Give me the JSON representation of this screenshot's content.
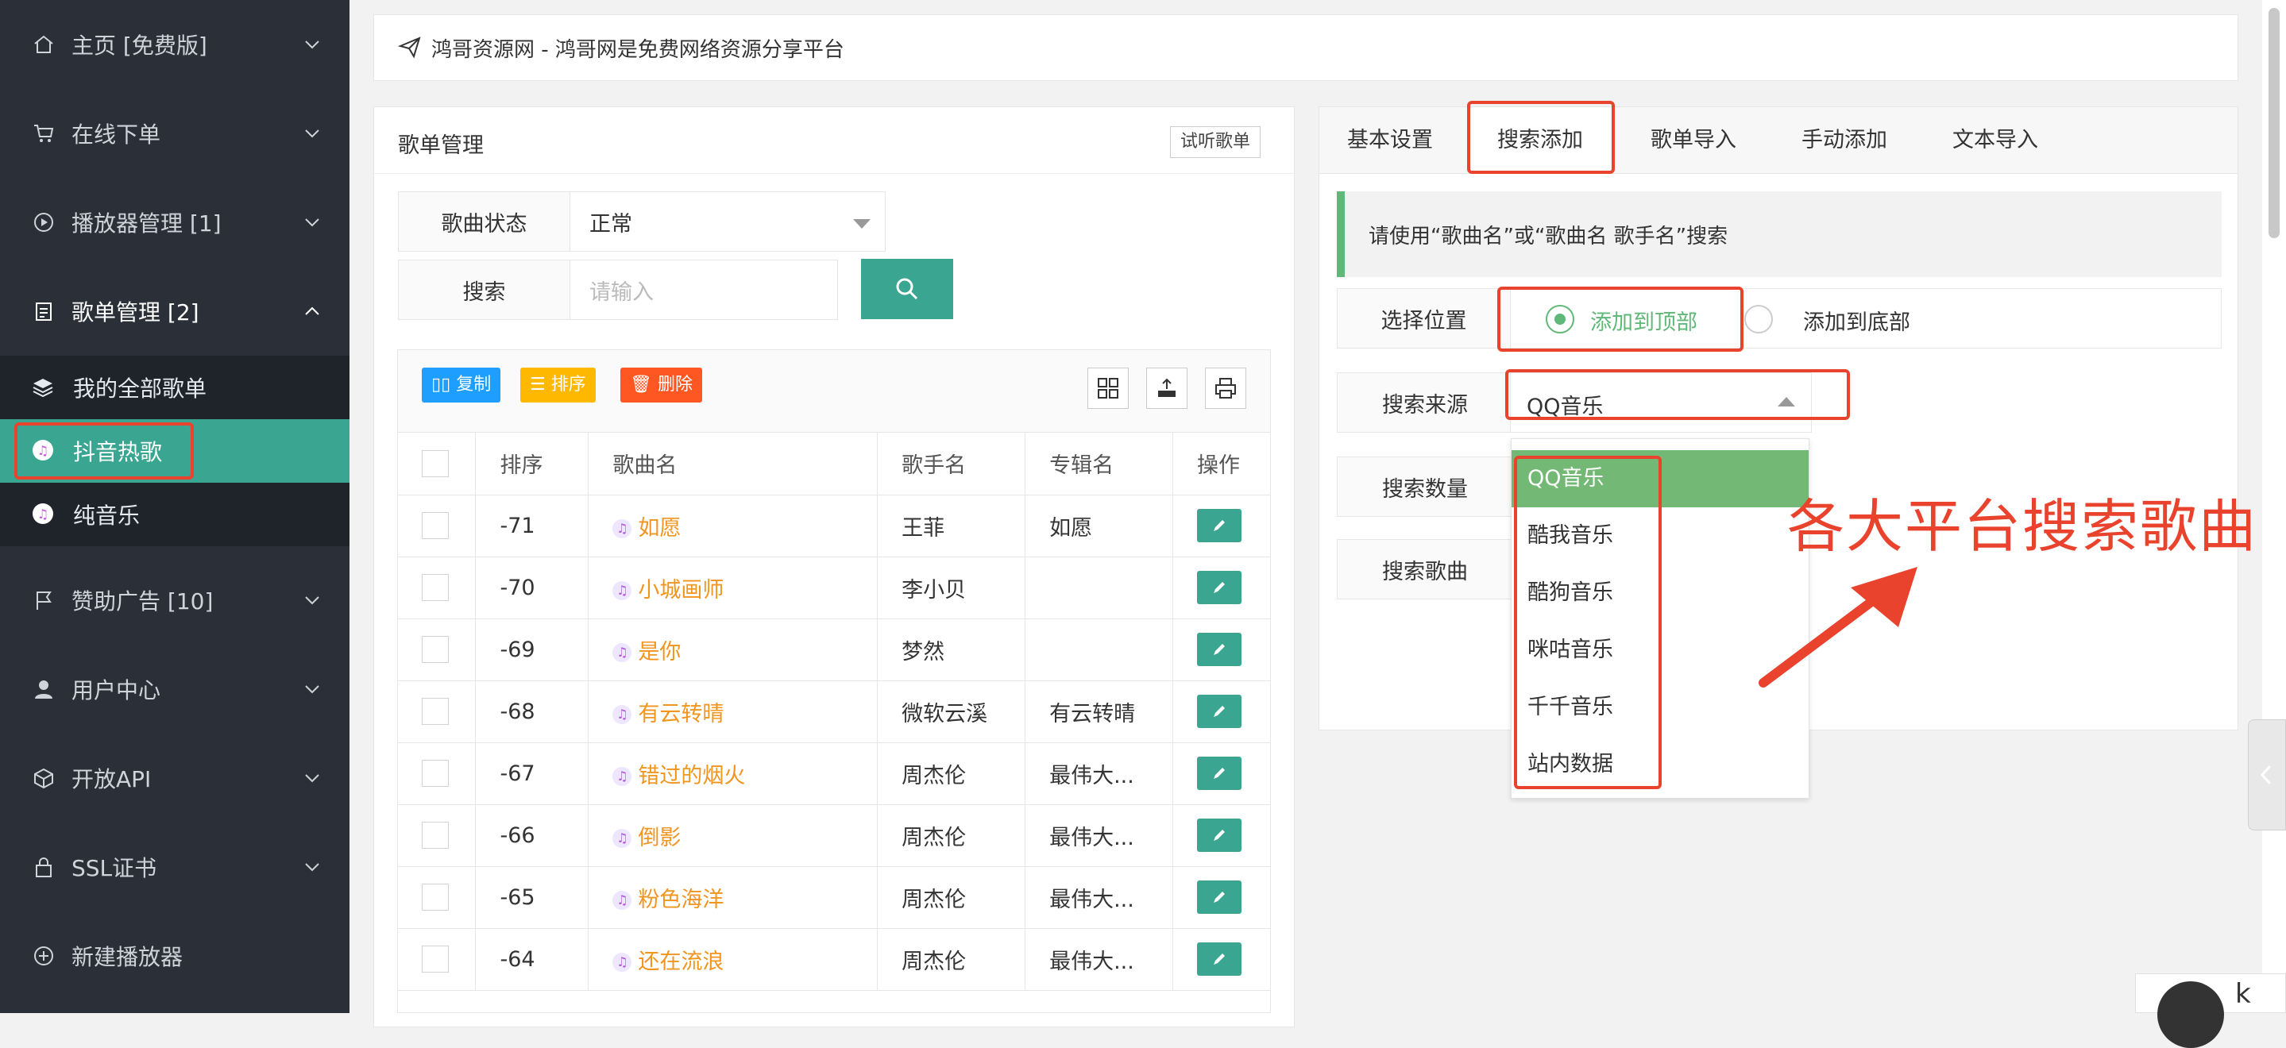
{
  "sidebar": {
    "items": [
      {
        "label": "主页 [免费版]"
      },
      {
        "label": "在线下单"
      },
      {
        "label": "播放器管理 [1]"
      },
      {
        "label": "歌单管理 [2]"
      },
      {
        "label": "赞助广告 [10]"
      },
      {
        "label": "用户中心"
      },
      {
        "label": "开放API"
      },
      {
        "label": "SSL证书"
      },
      {
        "label": "新建播放器"
      }
    ],
    "subitems": [
      {
        "label": "我的全部歌单"
      },
      {
        "label": "抖音热歌"
      },
      {
        "label": "纯音乐"
      }
    ]
  },
  "topbar": {
    "title": "鸿哥资源网 - 鸿哥网是免费网络资源分享平台"
  },
  "left_panel": {
    "title": "歌单管理",
    "listen_button": "试听歌单",
    "status_label": "歌曲状态",
    "status_value": "正常",
    "search_label": "搜索",
    "search_placeholder": "请输入",
    "toolbar": {
      "copy": "复制",
      "sort": "排序",
      "delete": "删除"
    },
    "columns": [
      "排序",
      "歌曲名",
      "歌手名",
      "专辑名",
      "操作"
    ],
    "rows": [
      {
        "order": "-71",
        "song": "如愿",
        "artist": "王菲",
        "album": "如愿"
      },
      {
        "order": "-70",
        "song": "小城画师",
        "artist": "李小贝",
        "album": ""
      },
      {
        "order": "-69",
        "song": "是你",
        "artist": "梦然",
        "album": ""
      },
      {
        "order": "-68",
        "song": "有云转晴",
        "artist": "微软云溪",
        "album": "有云转晴"
      },
      {
        "order": "-67",
        "song": "错过的烟火",
        "artist": "周杰伦",
        "album": "最伟大..."
      },
      {
        "order": "-66",
        "song": "倒影",
        "artist": "周杰伦",
        "album": "最伟大..."
      },
      {
        "order": "-65",
        "song": "粉色海洋",
        "artist": "周杰伦",
        "album": "最伟大..."
      },
      {
        "order": "-64",
        "song": "还在流浪",
        "artist": "周杰伦",
        "album": "最伟大..."
      }
    ]
  },
  "right_panel": {
    "tabs": [
      "基本设置",
      "搜索添加",
      "歌单导入",
      "手动添加",
      "文本导入"
    ],
    "tip": "请使用“歌曲名”或“歌曲名 歌手名”搜索",
    "position_label": "选择位置",
    "position_options": [
      "添加到顶部",
      "添加到底部"
    ],
    "source_label": "搜索来源",
    "source_value": "QQ音乐",
    "count_label": "搜索数量",
    "song_label": "搜索歌曲",
    "dropdown_options": [
      "QQ音乐",
      "酷我音乐",
      "酷狗音乐",
      "咪咕音乐",
      "千千音乐",
      "站内数据"
    ]
  },
  "annotation": "各大平台搜索歌曲",
  "corner": {
    "text": "k"
  }
}
